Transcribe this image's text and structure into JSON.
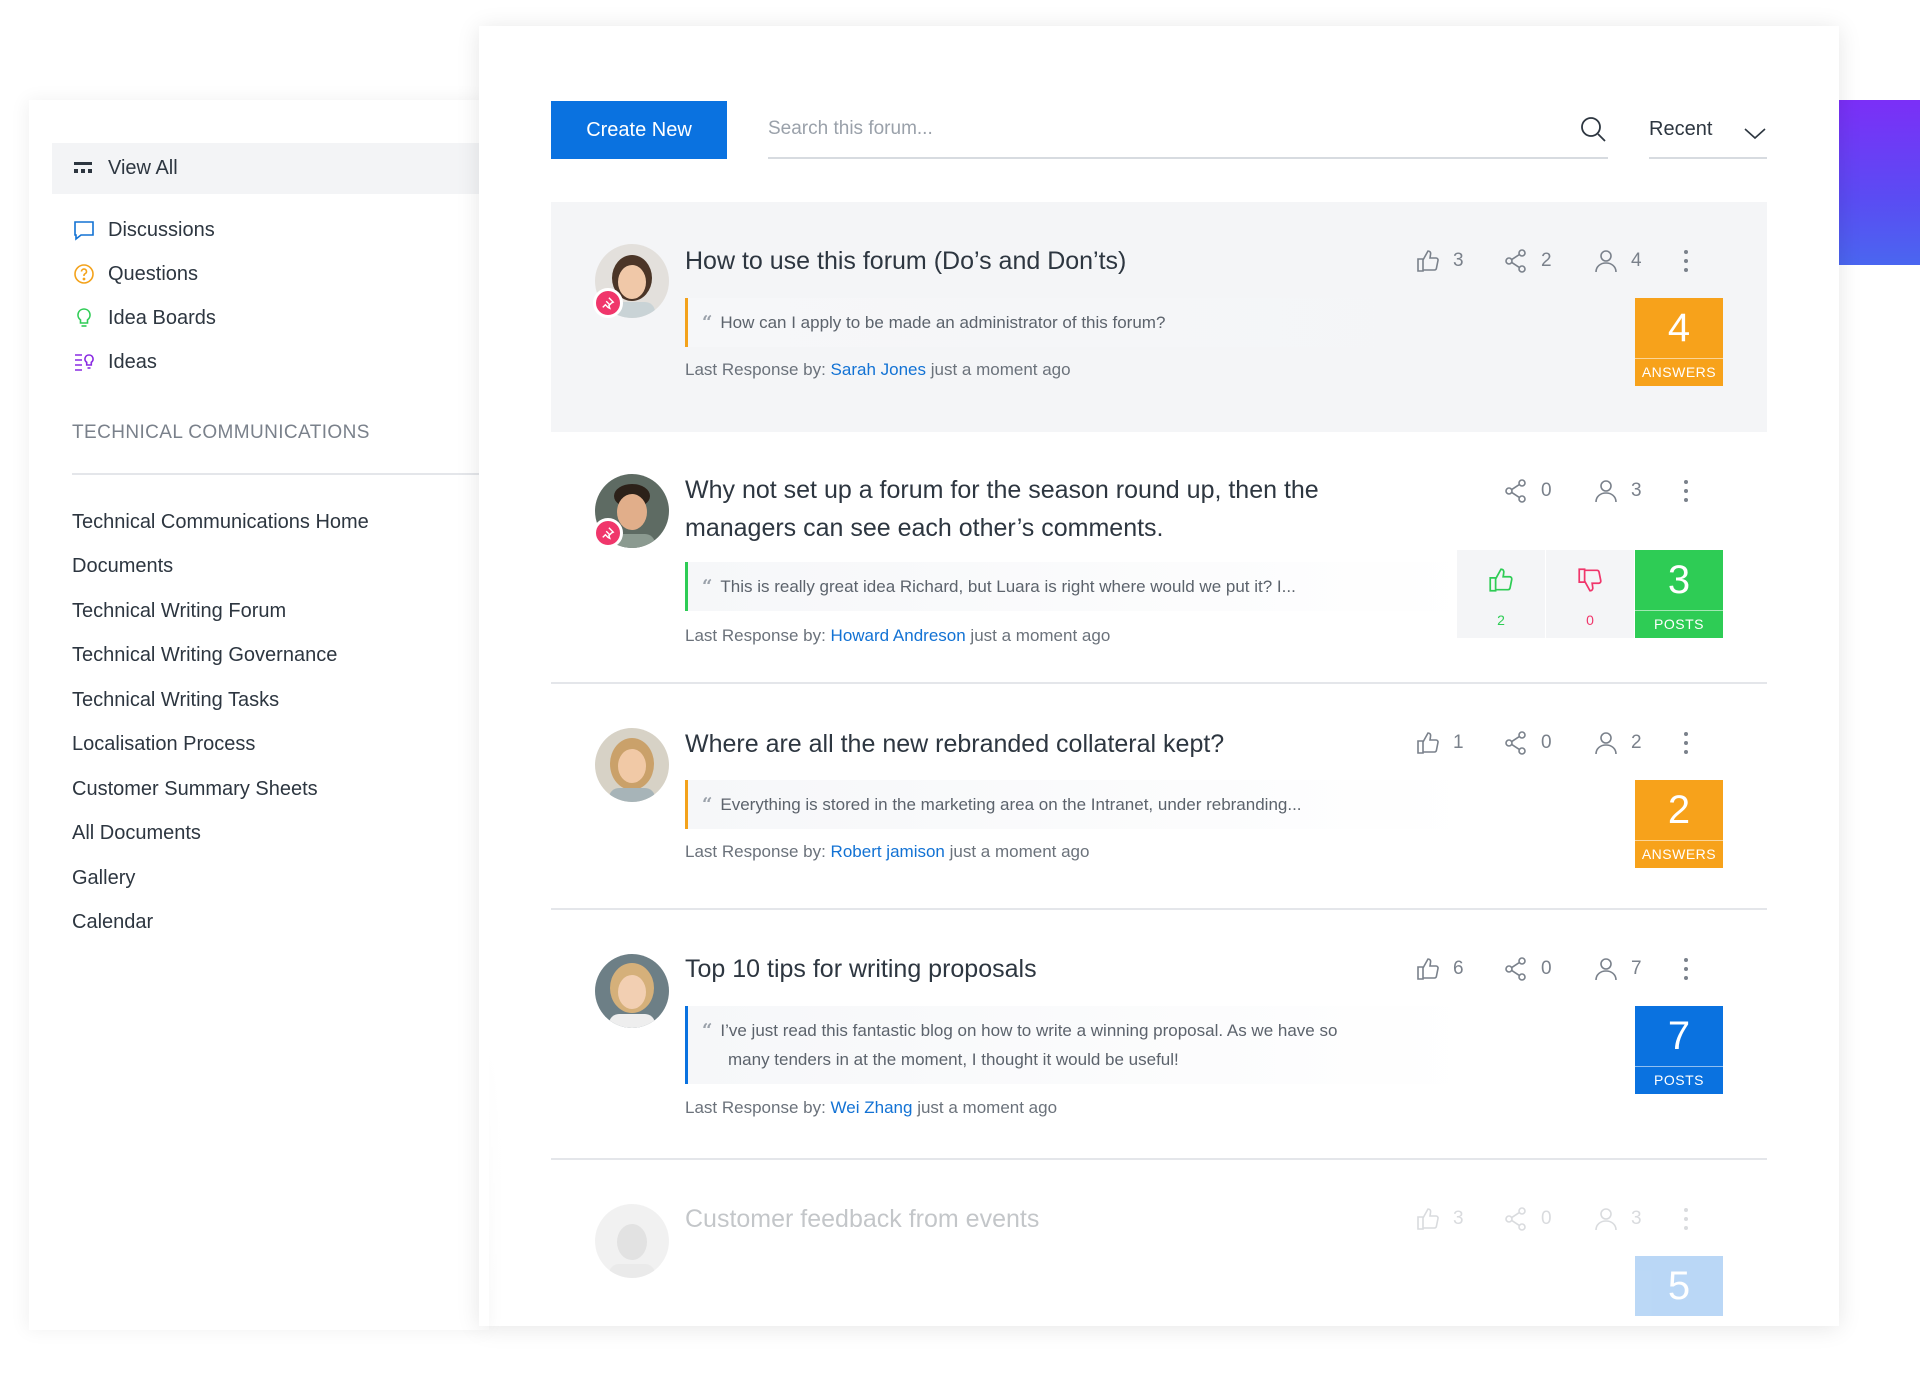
{
  "sidebar": {
    "view_all": "View All",
    "nav": [
      {
        "label": "Discussions",
        "icon": "chat-bubble-icon",
        "color": "#1272d4"
      },
      {
        "label": "Questions",
        "icon": "question-circle-icon",
        "color": "#f3a21b"
      },
      {
        "label": "Idea Boards",
        "icon": "lightbulb-icon",
        "color": "#2ecc55"
      },
      {
        "label": "Ideas",
        "icon": "ideas-list-icon",
        "color": "#8a2be2"
      }
    ],
    "section_title": "TECHNICAL COMMUNICATIONS",
    "links": [
      "Technical Communications Home",
      "Documents",
      "Technical Writing Forum",
      "Technical Writing Governance",
      "Technical Writing Tasks",
      "Localisation Process",
      "Customer Summary Sheets",
      "All Documents",
      "Gallery",
      "Calendar"
    ]
  },
  "toolbar": {
    "create_label": "Create New",
    "search_placeholder": "Search this forum...",
    "sort_label": "Recent"
  },
  "posts": [
    {
      "title": "How to use this forum (Do’s and Don’ts)",
      "quote": "How can I apply to be made an administrator of this forum?",
      "response_prefix": "Last Response by:",
      "author": "Sarah Jones",
      "time": "just a moment ago",
      "likes": "3",
      "shares": "2",
      "followers": "4",
      "badge_value": "4",
      "badge_label": "ANSWERS",
      "badge_color": "#f7a21b",
      "quote_color": "#f3a21b",
      "pinned": true
    },
    {
      "title_line1": "Why not set up a forum for the season round up, then the",
      "title_line2": "managers can see each other’s comments.",
      "quote": "This is really great idea Richard, but Luara is right where would we put it? I...",
      "response_prefix": "Last Response by:",
      "author": "Howard Andreson",
      "time": "just a moment ago",
      "shares": "0",
      "followers": "3",
      "upvotes": "2",
      "downvotes": "0",
      "badge_value": "3",
      "badge_label": "POSTS",
      "badge_color": "#2ecc55",
      "quote_color": "#2ecc55",
      "pinned": true
    },
    {
      "title": "Where are all the new rebranded collateral kept?",
      "quote": "Everything is stored in the marketing area on the Intranet, under rebranding...",
      "response_prefix": "Last Response by:",
      "author": "Robert jamison",
      "time": "just a moment ago",
      "likes": "1",
      "shares": "0",
      "followers": "2",
      "badge_value": "2",
      "badge_label": "ANSWERS",
      "badge_color": "#f7a21b",
      "quote_color": "#f3a21b",
      "pinned": false
    },
    {
      "title": "Top 10 tips for writing proposals",
      "quote_line1": "I’ve just read this fantastic blog on how to write a winning proposal. As we have so",
      "quote_line2": "many tenders in at the moment, I thought it would be useful!",
      "response_prefix": "Last Response by:",
      "author": "Wei Zhang",
      "time": "just a moment ago",
      "likes": "6",
      "shares": "0",
      "followers": "7",
      "badge_value": "7",
      "badge_label": "POSTS",
      "badge_color": "#0a72e0",
      "quote_color": "#0a72e0",
      "pinned": false
    },
    {
      "title": "Customer feedback from events",
      "likes": "3",
      "shares": "0",
      "followers": "3",
      "badge_value": "5",
      "badge_color": "#0a72e0",
      "quote_color": "#0a72e0",
      "pinned": false
    }
  ],
  "colors": {
    "accent": "#0a72e0",
    "link": "#1272d4",
    "pin": "#f0366b",
    "upvote": "#2ecc55",
    "downvote": "#f0366b"
  }
}
